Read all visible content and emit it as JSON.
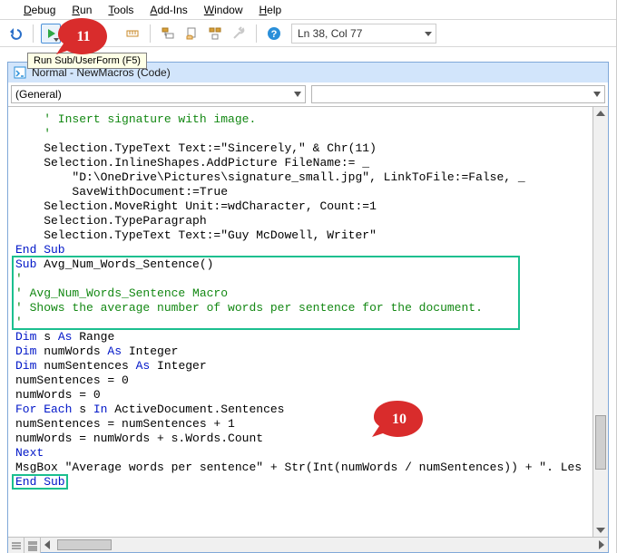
{
  "menu": {
    "items": [
      {
        "key": "D",
        "rest": "ebug"
      },
      {
        "key": "R",
        "rest": "un"
      },
      {
        "key": "T",
        "rest": "ools"
      },
      {
        "key": "A",
        "rest": "dd-Ins"
      },
      {
        "key": "W",
        "rest": "indow"
      },
      {
        "key": "H",
        "rest": "elp"
      }
    ]
  },
  "toolbar": {
    "cursor": "Ln 38, Col 77",
    "tooltip": "Run Sub/UserForm (F5)"
  },
  "annotations": {
    "step10": "10",
    "step11": "11"
  },
  "window": {
    "title": "Normal - NewMacros (Code)",
    "object_combo": "(General)",
    "proc_combo": ""
  },
  "code": {
    "lines": [
      {
        "cls": "cm",
        "text": "    ' Insert signature with image."
      },
      {
        "cls": "cm",
        "text": "    '"
      },
      {
        "cls": "plain",
        "text": "    Selection.TypeText Text:=\"Sincerely,\" & Chr(11)"
      },
      {
        "cls": "plain",
        "text": "    Selection.InlineShapes.AddPicture FileName:= _"
      },
      {
        "cls": "plain",
        "text": "        \"D:\\OneDrive\\Pictures\\signature_small.jpg\", LinkToFile:=False, _"
      },
      {
        "cls": "plain",
        "text": "        SaveWithDocument:=True"
      },
      {
        "cls": "plain",
        "text": "    Selection.MoveRight Unit:=wdCharacter, Count:=1"
      },
      {
        "cls": "plain",
        "text": "    Selection.TypeParagraph"
      },
      {
        "cls": "plain",
        "text": "    Selection.TypeText Text:=\"Guy McDowell, Writer\""
      },
      {
        "cls": "kw",
        "text": "End Sub"
      },
      {
        "cls": "mix1",
        "text": ""
      },
      {
        "cls": "cm",
        "text": "'"
      },
      {
        "cls": "cm",
        "text": "' Avg_Num_Words_Sentence Macro"
      },
      {
        "cls": "cm",
        "text": "' Shows the average number of words per sentence for the document."
      },
      {
        "cls": "cm",
        "text": "'"
      },
      {
        "cls": "mix2",
        "text": ""
      },
      {
        "cls": "mix3",
        "text": ""
      },
      {
        "cls": "mix4",
        "text": ""
      },
      {
        "cls": "plain",
        "text": "numSentences = 0"
      },
      {
        "cls": "plain",
        "text": "numWords = 0"
      },
      {
        "cls": "mix5",
        "text": ""
      },
      {
        "cls": "plain",
        "text": "numSentences = numSentences + 1"
      },
      {
        "cls": "plain",
        "text": "numWords = numWords + s.Words.Count"
      },
      {
        "cls": "kw",
        "text": "Next"
      },
      {
        "cls": "mix6",
        "text": ""
      },
      {
        "cls": "kw",
        "text": "End Sub"
      }
    ],
    "mix": {
      "sub_kw": "Sub",
      "sub_name": " Avg_Num_Words_Sentence()",
      "dim_kw": "Dim",
      "as_kw": " As ",
      "range_t": "Range",
      "int_t": "Integer",
      "s_var": " s",
      "nw_var": " numWords",
      "ns_var": " numSentences",
      "for_kw": "For Each",
      "in_kw": " In ",
      "for_rest": "ActiveDocument.Sentences",
      "for_s": " s",
      "msg_pre": "MsgBox ",
      "msg_rest": "\"Average words per sentence\" + Str(Int(numWords / numSentences)) + \". Les"
    }
  }
}
